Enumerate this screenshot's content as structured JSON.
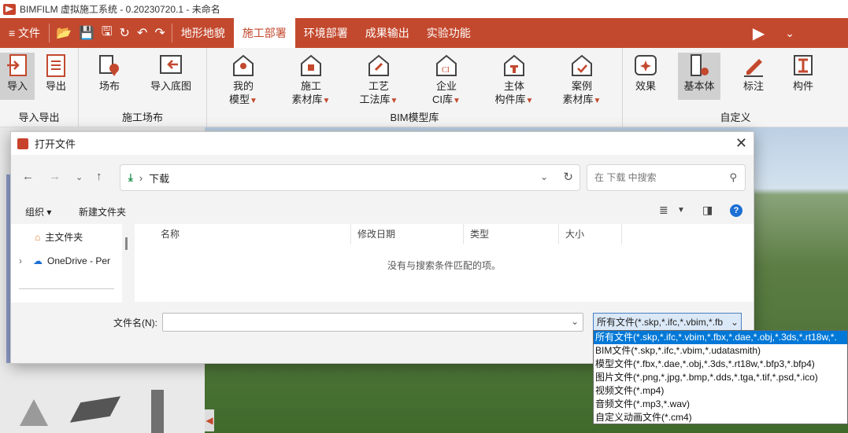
{
  "window": {
    "title": "BIMFILM 虚拟施工系统 - 0.20230720.1 - 未命名"
  },
  "menubar": {
    "file_label": "≡ 文件",
    "tabs": [
      {
        "label": "地形地貌"
      },
      {
        "label": "施工部署"
      },
      {
        "label": "环境部署"
      },
      {
        "label": "成果输出"
      },
      {
        "label": "实验功能"
      }
    ],
    "active_tab": "施工部署"
  },
  "ribbon": {
    "groups": {
      "import_export": {
        "label": "导入导出",
        "buttons": [
          {
            "label": "导入"
          },
          {
            "label": "导出"
          }
        ]
      },
      "site": {
        "label": "施工场布",
        "buttons": [
          {
            "label": "场布"
          },
          {
            "label": "导入底图"
          }
        ]
      },
      "bim_library": {
        "label": "BIM模型库",
        "buttons": [
          {
            "line1": "我的",
            "line2": "模型"
          },
          {
            "line1": "施工",
            "line2": "素材库"
          },
          {
            "line1": "工艺",
            "line2": "工法库"
          },
          {
            "line1": "企业",
            "line2": "CI库"
          },
          {
            "line1": "主体",
            "line2": "构件库"
          },
          {
            "line1": "案例",
            "line2": "素材库"
          }
        ]
      },
      "custom": {
        "label": "自定义",
        "buttons": [
          {
            "label": "效果"
          },
          {
            "label": "基本体"
          },
          {
            "label": "标注"
          },
          {
            "label": "构件"
          }
        ]
      }
    }
  },
  "dialog": {
    "title": "打开文件",
    "address": {
      "crumb": "下载"
    },
    "search": {
      "placeholder": "在 下载 中搜索"
    },
    "commands": {
      "organize": "组织 ▾",
      "new_folder": "新建文件夹"
    },
    "nav_pane": {
      "items": [
        {
          "label": "主文件夹"
        },
        {
          "label": "OneDrive - Per"
        }
      ]
    },
    "columns": [
      "名称",
      "修改日期",
      "类型",
      "大小"
    ],
    "empty_message": "没有与搜索条件匹配的项。",
    "filename": {
      "label": "文件名(N):",
      "value": ""
    },
    "filetype": {
      "selected": "所有文件(*.skp,*.ifc,*.vbim,*.fb"
    }
  },
  "filetype_dropdown": {
    "options": [
      "所有文件(*.skp,*.ifc,*.vbim,*.fbx,*.dae,*.obj,*.3ds,*.rt18w,*.",
      "BIM文件(*.skp,*.ifc,*.vbim,*.udatasmith)",
      "模型文件(*.fbx,*.dae,*.obj,*.3ds,*.rt18w,*.bfp3,*.bfp4)",
      "图片文件(*.png,*.jpg,*.bmp,*.dds,*.tga,*.tif,*.psd,*.ico)",
      "视频文件(*.mp4)",
      "音频文件(*.mp3,*.wav)",
      "自定义动画文件(*.cm4)"
    ],
    "selected_index": 0
  },
  "colors": {
    "brand": "#c3492e",
    "selection": "#0078d7"
  }
}
